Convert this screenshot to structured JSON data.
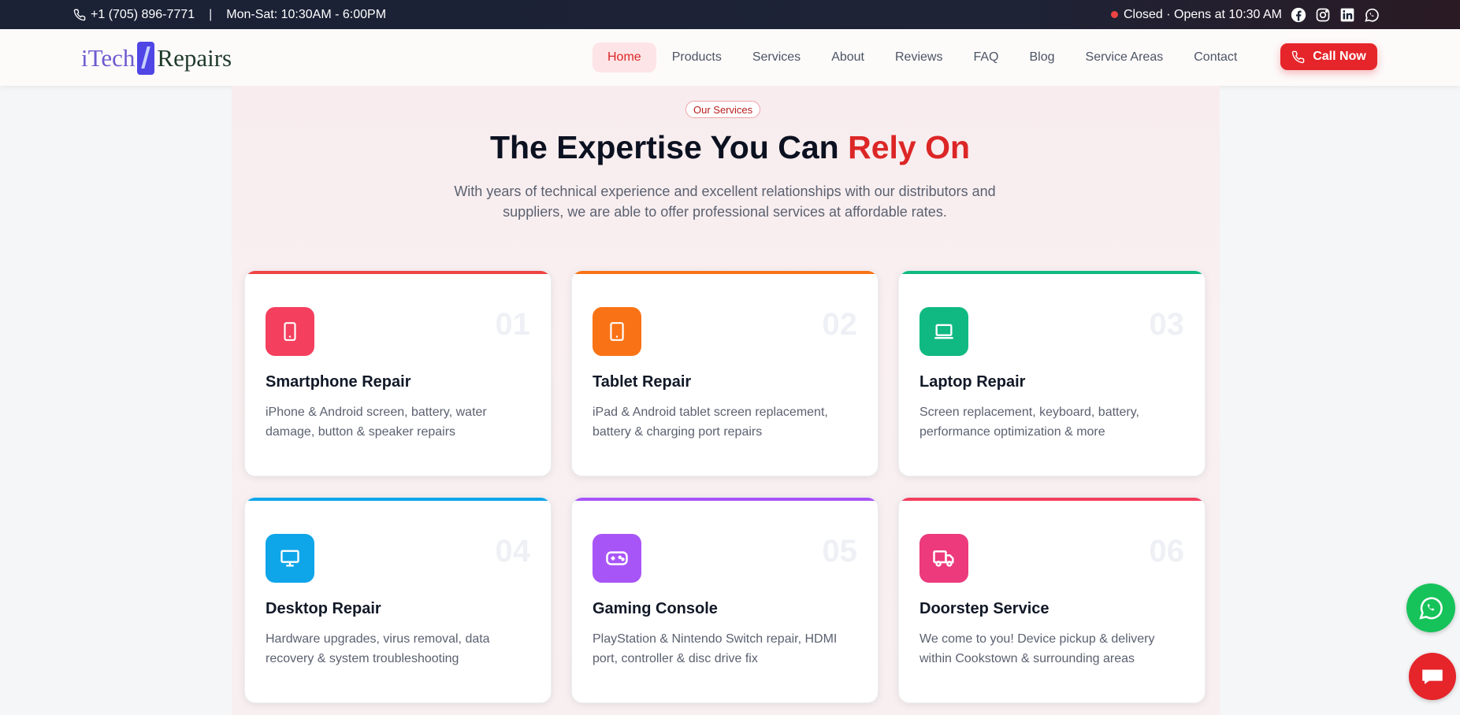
{
  "topbar": {
    "phone": "+1 (705) 896-7771",
    "separator": "|",
    "hours": "Mon-Sat: 10:30AM - 6:00PM",
    "status": "Closed · Opens at 10:30 AM",
    "social_icons": [
      "facebook-icon",
      "instagram-icon",
      "linkedin-icon",
      "whatsapp-icon"
    ]
  },
  "nav": {
    "logo": {
      "part1": "iTech",
      "part2": "Repairs"
    },
    "items": [
      {
        "label": "Home",
        "active": true
      },
      {
        "label": "Products"
      },
      {
        "label": "Services"
      },
      {
        "label": "About"
      },
      {
        "label": "Reviews"
      },
      {
        "label": "FAQ"
      },
      {
        "label": "Blog"
      },
      {
        "label": "Service Areas"
      },
      {
        "label": "Contact"
      }
    ],
    "call_button": "Call Now"
  },
  "section": {
    "badge": "Our Services",
    "title_main": "The Expertise You Can",
    "title_accent": "Rely On",
    "subtitle": "With years of technical experience and excellent relationships with our distributors and suppliers, we are able to offer professional services at affordable rates."
  },
  "cards": [
    {
      "num": "01",
      "title": "Smartphone Repair",
      "desc": "iPhone & Android screen, battery, water damage, button & speaker repairs",
      "icon": "smartphone-icon",
      "color": "#f43f5e"
    },
    {
      "num": "02",
      "title": "Tablet Repair",
      "desc": "iPad & Android tablet screen replacement, battery & charging port repairs",
      "icon": "tablet-icon",
      "color": "#f97316"
    },
    {
      "num": "03",
      "title": "Laptop Repair",
      "desc": "Screen replacement, keyboard, battery, performance optimization & more",
      "icon": "laptop-icon",
      "color": "#10b981"
    },
    {
      "num": "04",
      "title": "Desktop Repair",
      "desc": "Hardware upgrades, virus removal, data recovery & system troubleshooting",
      "icon": "monitor-icon",
      "color": "#0ea5e9"
    },
    {
      "num": "05",
      "title": "Gaming Console",
      "desc": "PlayStation & Nintendo Switch repair, HDMI port, controller & disc drive fix",
      "icon": "gamepad-icon",
      "color": "#a855f7"
    },
    {
      "num": "06",
      "title": "Doorstep Service",
      "desc": "We come to you! Device pickup & delivery within Cookstown & surrounding areas",
      "icon": "truck-icon",
      "color": "#f43f5e"
    }
  ]
}
